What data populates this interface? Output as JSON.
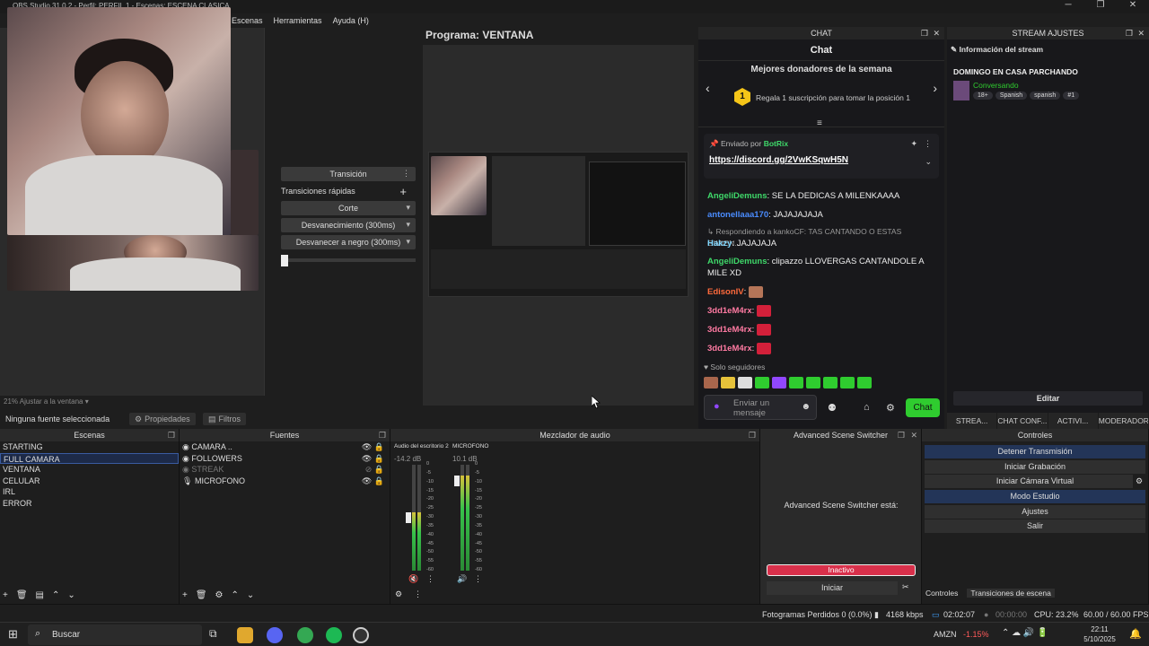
{
  "titlebar": {
    "title": "OBS Studio 31.0.2 - Perfil: PERFIL 1 - Escenas: ESCENA CLASICA",
    "minimize": "─",
    "maximize": "❐",
    "close": "✕"
  },
  "menu": {
    "items": [
      "Escenas",
      "Herramientas",
      "Ayuda (H)"
    ]
  },
  "program": {
    "title": "Programa: VENTANA"
  },
  "transitions": {
    "transition_label": "Transición",
    "quick_label": "Transiciones rápidas",
    "buttons": [
      "Corte",
      "Desvanecimiento (300ms)",
      "Desvanecer a negro (300ms)"
    ]
  },
  "preview_status": "21% Ajustar a la ventana",
  "source_bar": {
    "no_source": "Ninguna fuente seleccionada",
    "properties": "Propiedades",
    "filters": "Filtros"
  },
  "chat": {
    "dock_title": "CHAT",
    "title": "Chat",
    "donors_title": "Mejores donadores de la semana",
    "donor_rank": "1",
    "donor_text": "Regala 1 suscripción para tomar la posición 1",
    "pinned_by": "Enviado por",
    "pinned_user": "BotRix",
    "pinned_link": "https://discord.gg/2VwKSqwH5N",
    "messages": [
      {
        "user": "AngeliDemuns",
        "sep": ":",
        "text": "SE LA DEDICAS A MILENKAAAA",
        "color": "#3fd96a"
      },
      {
        "user": "antonellaaa170",
        "sep": ":",
        "text": "JAJAJAJAJA",
        "color": "#4a8cff"
      },
      {
        "reply": "Respondiendo a kankoCF: TAS CANTANDO O ESTAS GIMIEN..."
      },
      {
        "user": "Hakzy",
        "sep": ":",
        "text": "JAJAJAJA",
        "color": "#7fd7ff"
      },
      {
        "user": "AngeliDemuns",
        "sep": ":",
        "text": "clipazzo LLOVERGAS CANTANDOLE A MILE XD",
        "color": "#3fd96a"
      },
      {
        "user": "EdisonIV",
        "sep": ":",
        "text": "",
        "color": "#ff6a3c"
      },
      {
        "user": "3dd1eM4rx",
        "sep": ":",
        "text": "",
        "color": "#ff7aa2"
      },
      {
        "user": "3dd1eM4rx",
        "sep": ":",
        "text": "",
        "color": "#ff7aa2"
      },
      {
        "user": "3dd1eM4rx",
        "sep": ":",
        "text": "",
        "color": "#ff7aa2"
      }
    ],
    "followers_only": "Solo seguidores",
    "input_placeholder": "Enviar un mensaje",
    "send_button": "Chat"
  },
  "stream_settings": {
    "dock_title": "STREAM AJUSTES",
    "info_header": "Información del stream",
    "stream_title": "DOMINGO EN CASA PARCHANDO",
    "category": "Conversando",
    "tags": [
      "18+",
      "Spanish",
      "spanish",
      "#1"
    ],
    "edit_button": "Editar",
    "tabs": [
      "STREA...",
      "CHAT CONF...",
      "ACTIVI...",
      "MODERADORE..."
    ]
  },
  "scenes": {
    "title": "Escenas",
    "items": [
      "STARTING",
      "FULL CAMARA",
      "VENTANA",
      "CELULAR",
      "IRL",
      "ERROR"
    ],
    "selected": "FULL CAMARA"
  },
  "sources": {
    "title": "Fuentes",
    "items": [
      {
        "name": "CAMARA ..",
        "visible": true
      },
      {
        "name": "FOLLOWERS",
        "visible": true
      },
      {
        "name": "STREAK",
        "visible": false
      },
      {
        "name": "MICROFONO",
        "visible": true
      }
    ]
  },
  "mixer": {
    "title": "Mezclador de audio",
    "channels": [
      {
        "name": "Audio del escritorio 2",
        "db": "-14.2 dB",
        "level": 0.55
      },
      {
        "name": "MICROFONO",
        "db": "10.1 dB",
        "level": 0.9
      }
    ],
    "scale": [
      "0",
      "-5",
      "-10",
      "-15",
      "-20",
      "-25",
      "-30",
      "-35",
      "-40",
      "-45",
      "-50",
      "-55",
      "-60"
    ]
  },
  "switcher": {
    "title": "Advanced Scene Switcher",
    "status_text": "Advanced Scene Switcher está:",
    "state": "Inactivo",
    "start": "Iniciar"
  },
  "controls": {
    "title": "Controles",
    "buttons": [
      "Detener Transmisión",
      "Iniciar Grabación",
      "Iniciar Cámara Virtual",
      "Modo Estudio",
      "Ajustes",
      "Salir"
    ],
    "tabs": [
      "Controles",
      "Transiciones de escena"
    ]
  },
  "statusbar": {
    "dropped": "Fotogramas Perdidos 0 (0.0%)",
    "bitrate": "4168 kbps",
    "live_time": "02:02:07",
    "rec_time": "00:00:00",
    "cpu": "CPU: 23.2%",
    "fps": "60.00 / 60.00 FPS"
  },
  "taskbar": {
    "search": "Buscar",
    "ticker": "AMZN",
    "ticker_change": "-1.15%",
    "time": "22:11",
    "date": "5/10/2025"
  }
}
